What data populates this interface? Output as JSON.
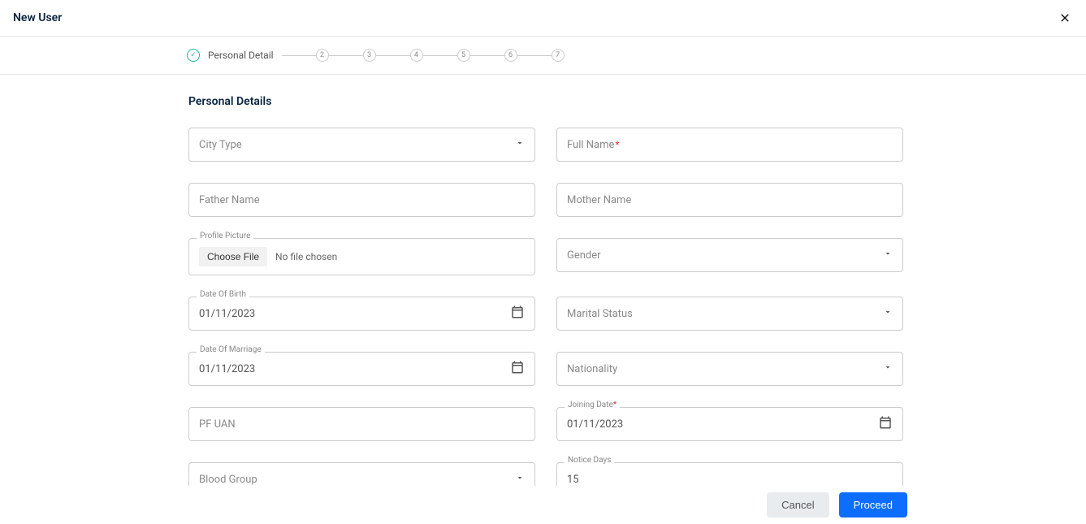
{
  "header": {
    "title": "New User"
  },
  "stepper": {
    "active_label": "Personal Detail",
    "steps": [
      "1",
      "2",
      "3",
      "4",
      "5",
      "6",
      "7"
    ]
  },
  "section": {
    "title": "Personal Details"
  },
  "fields": {
    "city_type": {
      "placeholder": "City Type"
    },
    "full_name": {
      "placeholder": "Full Name",
      "required_mark": "*"
    },
    "father_name": {
      "placeholder": "Father Name"
    },
    "mother_name": {
      "placeholder": "Mother Name"
    },
    "profile_picture": {
      "label": "Profile Picture",
      "button": "Choose File",
      "status": "No file chosen"
    },
    "gender": {
      "placeholder": "Gender"
    },
    "dob": {
      "label": "Date Of Birth",
      "value": "01/11/2023"
    },
    "marital_status": {
      "placeholder": "Marital Status"
    },
    "dom": {
      "label": "Date Of Marriage",
      "value": "01/11/2023"
    },
    "nationality": {
      "placeholder": "Nationality"
    },
    "pf_uan": {
      "placeholder": "PF UAN"
    },
    "joining_date": {
      "label": "Joining Date",
      "required_mark": "*",
      "value": "01/11/2023"
    },
    "blood_group": {
      "placeholder": "Blood Group"
    },
    "notice_days": {
      "label": "Notice Days",
      "value": "15"
    }
  },
  "footer": {
    "cancel": "Cancel",
    "proceed": "Proceed"
  }
}
